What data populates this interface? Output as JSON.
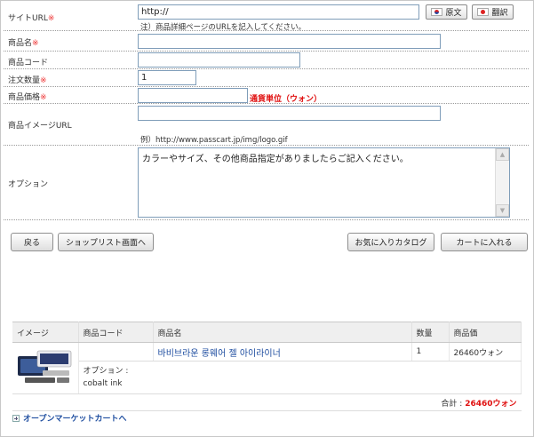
{
  "form": {
    "site_url": {
      "label": "サイトURL",
      "value": "http://",
      "note": "注）商品詳細ページのURLを記入してください。"
    },
    "buttons_lang": {
      "original": "原文",
      "translate": "翻訳"
    },
    "product_name": {
      "label": "商品名",
      "value": ""
    },
    "product_code": {
      "label": "商品コード",
      "value": ""
    },
    "quantity": {
      "label": "注文数量",
      "value": "1"
    },
    "price": {
      "label": "商品価格",
      "value": "",
      "currency_note": "通貨単位（ウォン）"
    },
    "image_url": {
      "label": "商品イメージURL",
      "value": "",
      "example": "例）http://www.passcart.jp/img/logo.gif"
    },
    "option": {
      "label": "オプション",
      "value": "カラーやサイズ、その他商品指定がありましたらご記入ください。"
    },
    "required_mark": "※"
  },
  "actions": {
    "back": "戻る",
    "shop_list": "ショップリスト画面へ",
    "favorites": "お気に入りカタログ",
    "add_cart": "カートに入れる"
  },
  "cart": {
    "headers": [
      "イメージ",
      "商品コード",
      "商品名",
      "数量",
      "商品価"
    ],
    "items": [
      {
        "code": "",
        "name": "바비브라운 롱웨어 젤 아이라이너",
        "quantity": "1",
        "price": "26460ウォン",
        "option_label": "オプション :",
        "option_value": "cobalt ink"
      }
    ],
    "total_label": "合計 :",
    "total_value": "26460ウォン"
  },
  "footer_link": "オープンマーケットカートへ",
  "colors": {
    "required": "#e33333",
    "accent_red": "#e01010",
    "link_blue": "#1f4ea0"
  }
}
